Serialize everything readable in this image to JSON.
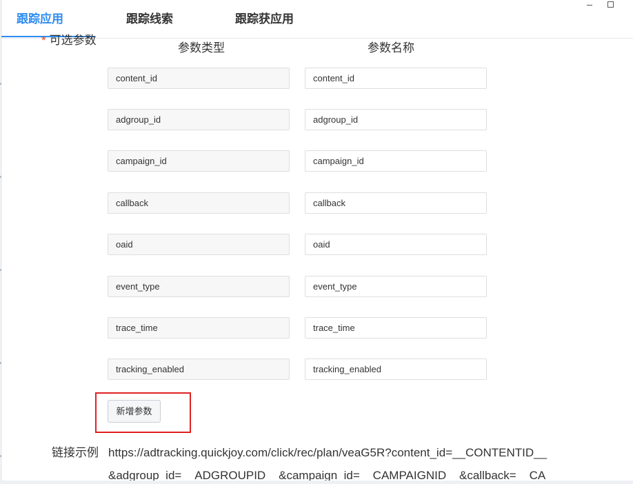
{
  "window": {
    "minimize_icon": "minimize-icon",
    "maximize_icon": "maximize-icon"
  },
  "tabs": [
    {
      "label": "跟踪应用",
      "active": true
    },
    {
      "label": "跟踪线索",
      "active": false
    },
    {
      "label": "跟踪获应用",
      "active": false
    }
  ],
  "optional_params": {
    "label": "可选参数",
    "required_marker": "*",
    "type_header": "参数类型",
    "name_header": "参数名称",
    "rows": [
      {
        "type": "content_id",
        "name": "content_id"
      },
      {
        "type": "adgroup_id",
        "name": "adgroup_id"
      },
      {
        "type": "campaign_id",
        "name": "campaign_id"
      },
      {
        "type": "callback",
        "name": "callback"
      },
      {
        "type": "oaid",
        "name": "oaid"
      },
      {
        "type": "event_type",
        "name": "event_type"
      },
      {
        "type": "trace_time",
        "name": "trace_time"
      },
      {
        "type": "tracking_enabled",
        "name": "tracking_enabled"
      }
    ],
    "add_button": "新增参数"
  },
  "link_example": {
    "label": "链接示例",
    "line1": "https://adtracking.quickjoy.com/click/rec/plan/veaG5R?content_id=__CONTENTID__",
    "line2": "&adgroup_id=__ADGROUPID__&campaign_id=__CAMPAIGNID__&callback=__CA"
  },
  "colors": {
    "accent": "#2d8cf0",
    "highlight": "#e02020",
    "required": "#ed4014"
  }
}
